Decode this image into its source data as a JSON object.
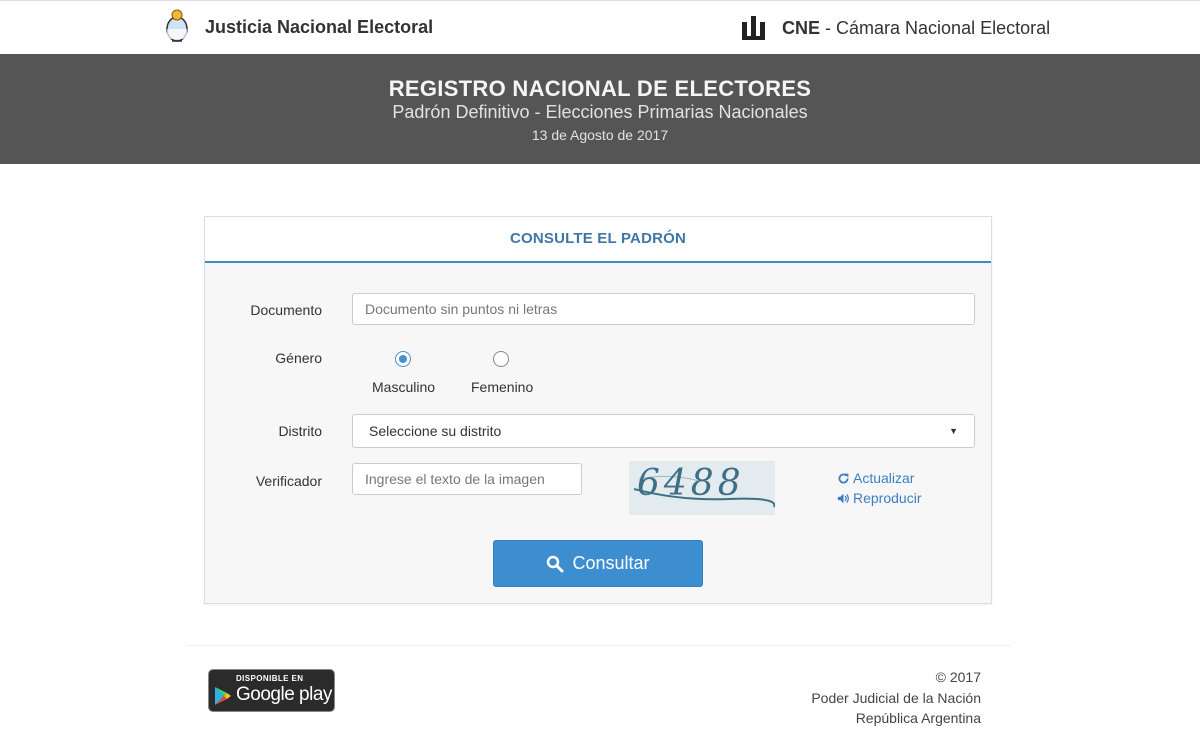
{
  "header": {
    "left_brand": "Justicia Nacional Electoral",
    "right_brand_bold": "CNE",
    "right_brand_rest": " - Cámara Nacional Electoral"
  },
  "banner": {
    "title": "REGISTRO NACIONAL DE ELECTORES",
    "subtitle": "Padrón Definitivo - Elecciones Primarias Nacionales",
    "date": "13 de Agosto de 2017"
  },
  "form": {
    "heading": "CONSULTE EL PADRÓN",
    "documento": {
      "label": "Documento",
      "placeholder": "Documento sin puntos ni letras",
      "value": ""
    },
    "genero": {
      "label": "Género",
      "options": [
        {
          "label": "Masculino",
          "selected": true
        },
        {
          "label": "Femenino",
          "selected": false
        }
      ]
    },
    "distrito": {
      "label": "Distrito",
      "selected": "Seleccione su distrito"
    },
    "verificador": {
      "label": "Verificador",
      "placeholder": "Ingrese el texto de la imagen",
      "captcha_text": "6488",
      "refresh_label": "Actualizar",
      "audio_label": "Reproducir"
    },
    "submit_label": "Consultar"
  },
  "footer": {
    "store_badge_small": "DISPONIBLE EN",
    "store_badge_big": "Google play",
    "copyright": "© 2017",
    "line1": "Poder Judicial de la Nación",
    "line2": "República Argentina"
  },
  "colors": {
    "banner_bg": "#555555",
    "accent": "#3d8dd1",
    "heading": "#3f76a6"
  },
  "icons": [
    "escudo-icon",
    "cne-logo-icon",
    "refresh-icon",
    "volume-icon",
    "search-icon",
    "google-play-icon"
  ]
}
